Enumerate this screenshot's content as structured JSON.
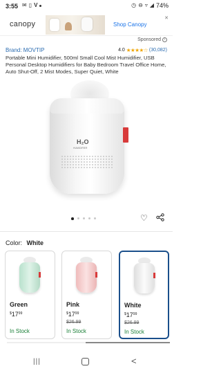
{
  "status_bar": {
    "time": "3:55",
    "left_icons": [
      "email-icon",
      "smartphone-icon",
      "v-app-icon",
      "dot-icon"
    ],
    "right_icons": [
      "alarm-icon",
      "dnd-icon",
      "wifi-icon",
      "signal-icon"
    ],
    "battery": "74%"
  },
  "ad": {
    "logo": "canopy",
    "cta": "Shop Canopy",
    "close": "✕"
  },
  "sponsored": "Sponsored",
  "product": {
    "brand": "Brand: MOVTIP",
    "rating": "4.0",
    "stars": "★★★★☆",
    "rating_count": "(30,082)",
    "title": "Portable Mini Humidifier, 500ml Small Cool Mist Humidifier, USB Personal Desktop Humidifiers for Baby Bedroom Travel Office Home, Auto Shut-Off, 2 Mist Modes, Super Quiet, White",
    "image_logo": "H₂O",
    "image_logo_sub": "HUMIDIFIER"
  },
  "carousel": {
    "total": 5,
    "active": 1
  },
  "color_selector": {
    "label": "Color:",
    "selected": "White"
  },
  "variants": [
    {
      "name": "Green",
      "price_symbol": "$",
      "price_whole": "17",
      "price_cents": "99",
      "old_price": "",
      "stock": "In Stock",
      "color": "green"
    },
    {
      "name": "Pink",
      "price_symbol": "$",
      "price_whole": "17",
      "price_cents": "99",
      "old_price": "$26.99",
      "stock": "In Stock",
      "color": "pink"
    },
    {
      "name": "White",
      "price_symbol": "$",
      "price_whole": "17",
      "price_cents": "99",
      "old_price": "$26.99",
      "stock": "In Stock",
      "color": "white"
    }
  ],
  "nav": {
    "recent": "|||",
    "back": "<"
  }
}
